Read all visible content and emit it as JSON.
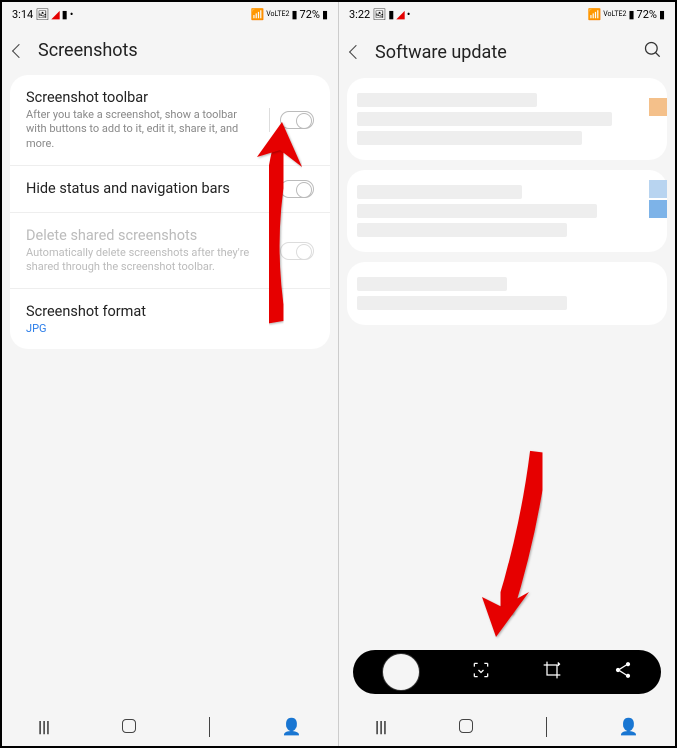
{
  "left": {
    "status": {
      "time": "3:14",
      "battery": "72%",
      "network": "VoLTE2"
    },
    "title": "Screenshots",
    "rows": [
      {
        "h": "Screenshot toolbar",
        "s": "After you take a screenshot, show a toolbar with buttons to add to it, edit it, share it, and more."
      },
      {
        "h": "Hide status and navigation bars"
      },
      {
        "h": "Delete shared screenshots",
        "s": "Automatically delete screenshots after they're shared through the screenshot toolbar."
      },
      {
        "h": "Screenshot format",
        "val": "JPG"
      }
    ]
  },
  "right": {
    "status": {
      "time": "3:22",
      "battery": "72%",
      "network": "VoLTE2"
    },
    "title": "Software update",
    "toolbar_icons": [
      "thumbnail",
      "scroll-capture",
      "crop",
      "share"
    ]
  }
}
